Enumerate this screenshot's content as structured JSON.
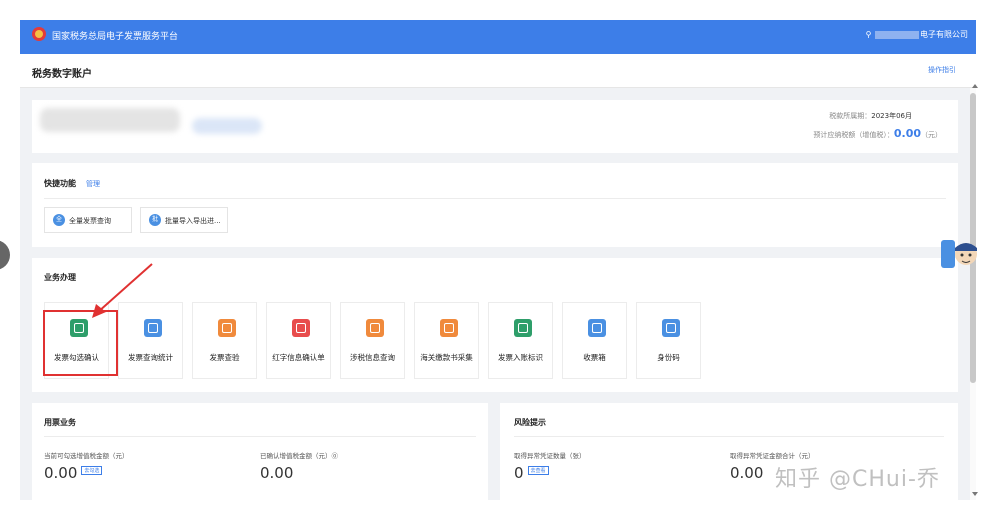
{
  "header": {
    "platform_title": "国家税务总局电子发票服务平台",
    "user_suffix": "电子有限公司"
  },
  "subheader": {
    "title": "税务数字账户",
    "guide_link": "操作指引"
  },
  "account": {
    "tax_period_label": "税款所属期：",
    "tax_period_value": "2023年06月",
    "estimated_tax_label": "预计应纳税额（增值税）：",
    "estimated_tax_value": "0.00",
    "estimated_tax_unit": "（元）"
  },
  "quick": {
    "title": "快捷功能",
    "manage": "管理",
    "buttons": [
      {
        "icon_text": "全",
        "label": "全量发票查询"
      },
      {
        "icon_text": "批",
        "label": "批量导入导出进..."
      }
    ]
  },
  "business": {
    "title": "业务办理",
    "tiles": [
      {
        "label": "发票勾选确认",
        "icon": "invoice-check-icon",
        "color": "#2e9e6a"
      },
      {
        "label": "发票查询统计",
        "icon": "invoice-search-icon",
        "color": "#4a90e2"
      },
      {
        "label": "发票查验",
        "icon": "invoice-verify-icon",
        "color": "#f08a3c"
      },
      {
        "label": "红字信息确认单",
        "icon": "red-letter-icon",
        "color": "#e84c4c"
      },
      {
        "label": "涉税信息查询",
        "icon": "tax-info-icon",
        "color": "#f08a3c"
      },
      {
        "label": "海关缴款书采集",
        "icon": "customs-icon",
        "color": "#f08a3c"
      },
      {
        "label": "发票入账标识",
        "icon": "ledger-icon",
        "color": "#2e9e6a"
      },
      {
        "label": "收票箱",
        "icon": "mailbox-icon",
        "color": "#4a90e2"
      },
      {
        "label": "身份码",
        "icon": "qr-code-icon",
        "color": "#4a90e2"
      }
    ]
  },
  "usage": {
    "title": "用票业务",
    "stats": [
      {
        "label": "当前可勾选增值税金额（元）",
        "value": "0.00",
        "badge": "去勾选"
      },
      {
        "label": "已确认增值税金额（元）⓪",
        "value": "0.00"
      }
    ]
  },
  "risk": {
    "title": "风险提示",
    "stats": [
      {
        "label": "取得异常凭证数量（张）",
        "value": "0",
        "badge": "去查看"
      },
      {
        "label": "取得异常凭证金额合计（元）",
        "value": "0.00"
      }
    ]
  },
  "watermark": "知乎 @CHui-乔",
  "colors": {
    "primary": "#3d7ee8",
    "highlight": "#e03131"
  }
}
